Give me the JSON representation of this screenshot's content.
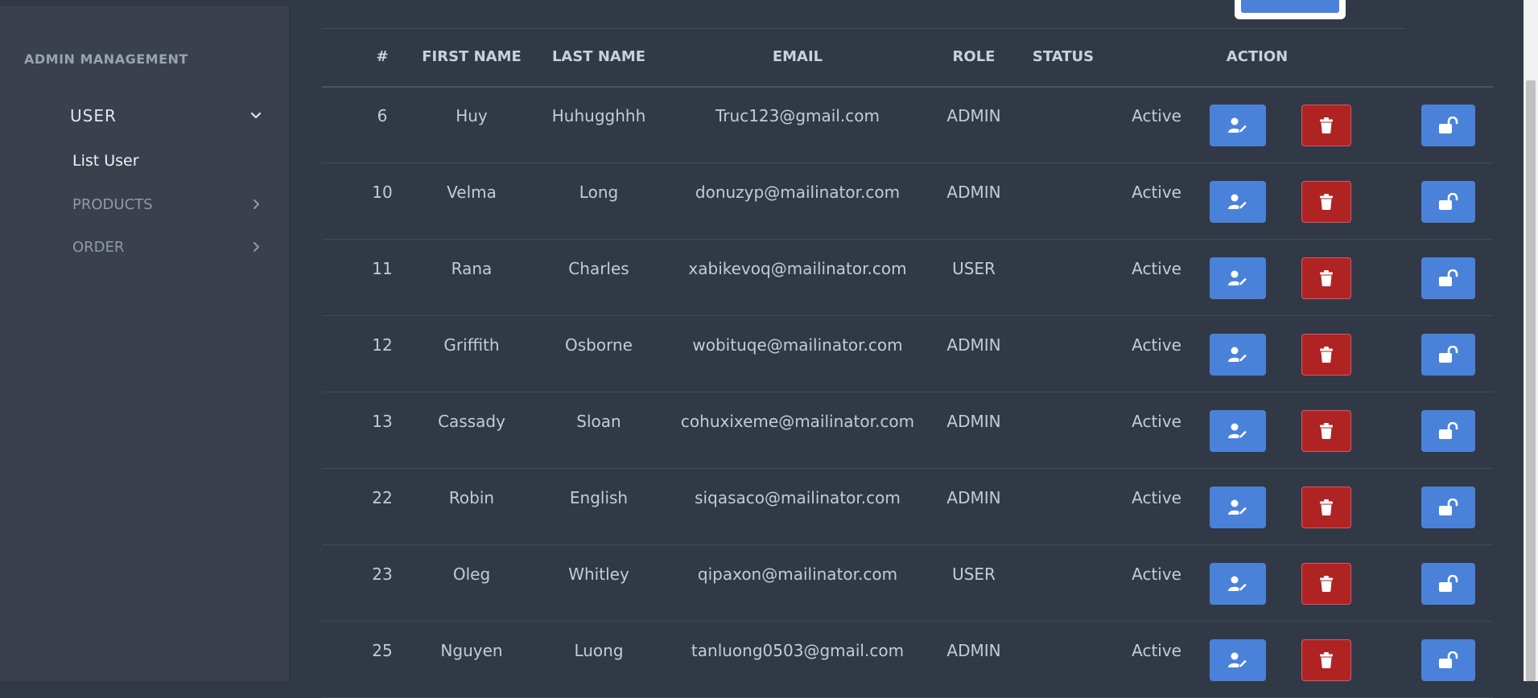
{
  "sidebar": {
    "title": "ADMIN MANAGEMENT",
    "user_label": "USER",
    "list_user_label": "List User",
    "products_label": "PRODUCTS",
    "order_label": "ORDER"
  },
  "table": {
    "headers": {
      "id": "#",
      "first_name": "FIRST NAME",
      "last_name": "LAST NAME",
      "email": "EMAIL",
      "role": "ROLE",
      "status": "STATUS",
      "action": "ACTION"
    },
    "rows": [
      {
        "id": "6",
        "first_name": "Huy",
        "last_name": "Huhugghhh",
        "email": "Truc123@gmail.com",
        "role": "ADMIN",
        "status": "Active"
      },
      {
        "id": "10",
        "first_name": "Velma",
        "last_name": "Long",
        "email": "donuzyp@mailinator.com",
        "role": "ADMIN",
        "status": "Active"
      },
      {
        "id": "11",
        "first_name": "Rana",
        "last_name": "Charles",
        "email": "xabikevoq@mailinator.com",
        "role": "USER",
        "status": "Active"
      },
      {
        "id": "12",
        "first_name": "Griffith",
        "last_name": "Osborne",
        "email": "wobituqe@mailinator.com",
        "role": "ADMIN",
        "status": "Active"
      },
      {
        "id": "13",
        "first_name": "Cassady",
        "last_name": "Sloan",
        "email": "cohuxixeme@mailinator.com",
        "role": "ADMIN",
        "status": "Active"
      },
      {
        "id": "22",
        "first_name": "Robin",
        "last_name": "English",
        "email": "siqasaco@mailinator.com",
        "role": "ADMIN",
        "status": "Active"
      },
      {
        "id": "23",
        "first_name": "Oleg",
        "last_name": "Whitley",
        "email": "qipaxon@mailinator.com",
        "role": "USER",
        "status": "Active"
      },
      {
        "id": "25",
        "first_name": "Nguyen",
        "last_name": "Luong",
        "email": "tanluong0503@gmail.com",
        "role": "ADMIN",
        "status": "Active"
      }
    ]
  },
  "icons": {
    "edit": "user-edit-icon",
    "delete": "trash-icon",
    "lock": "unlock-icon",
    "expand": "chevron-down-icon",
    "collapse": "chevron-right-icon"
  },
  "colors": {
    "background": "#323946",
    "sidebar": "#3a414c",
    "primary_button": "#4a82da",
    "danger_button": "#b02323"
  }
}
